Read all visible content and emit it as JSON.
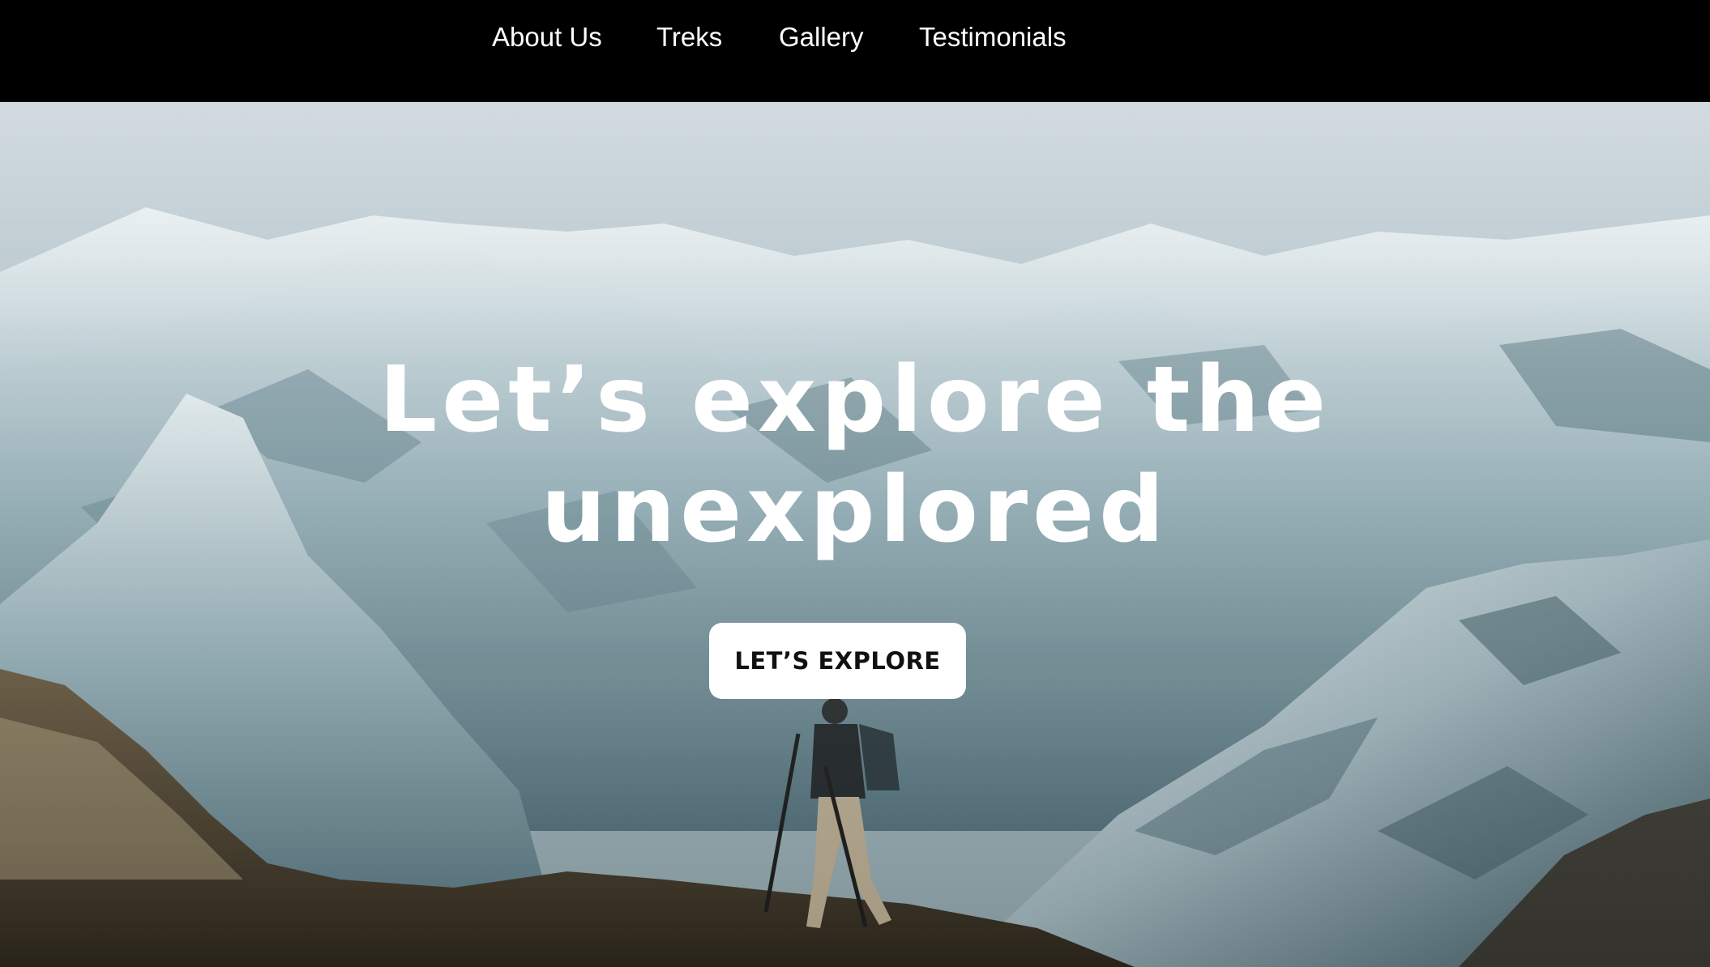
{
  "nav": {
    "items": [
      {
        "label": "About Us"
      },
      {
        "label": "Treks"
      },
      {
        "label": "Gallery"
      },
      {
        "label": "Testimonials"
      }
    ]
  },
  "hero": {
    "title_line1": "Let’s explore the",
    "title_line2": "unexplored",
    "cta_label": "LET’S EXPLORE"
  },
  "colors": {
    "nav_background": "#000000",
    "nav_text": "#ffffff",
    "hero_text": "#ffffff",
    "button_background": "#ffffff",
    "button_text": "#111111"
  }
}
